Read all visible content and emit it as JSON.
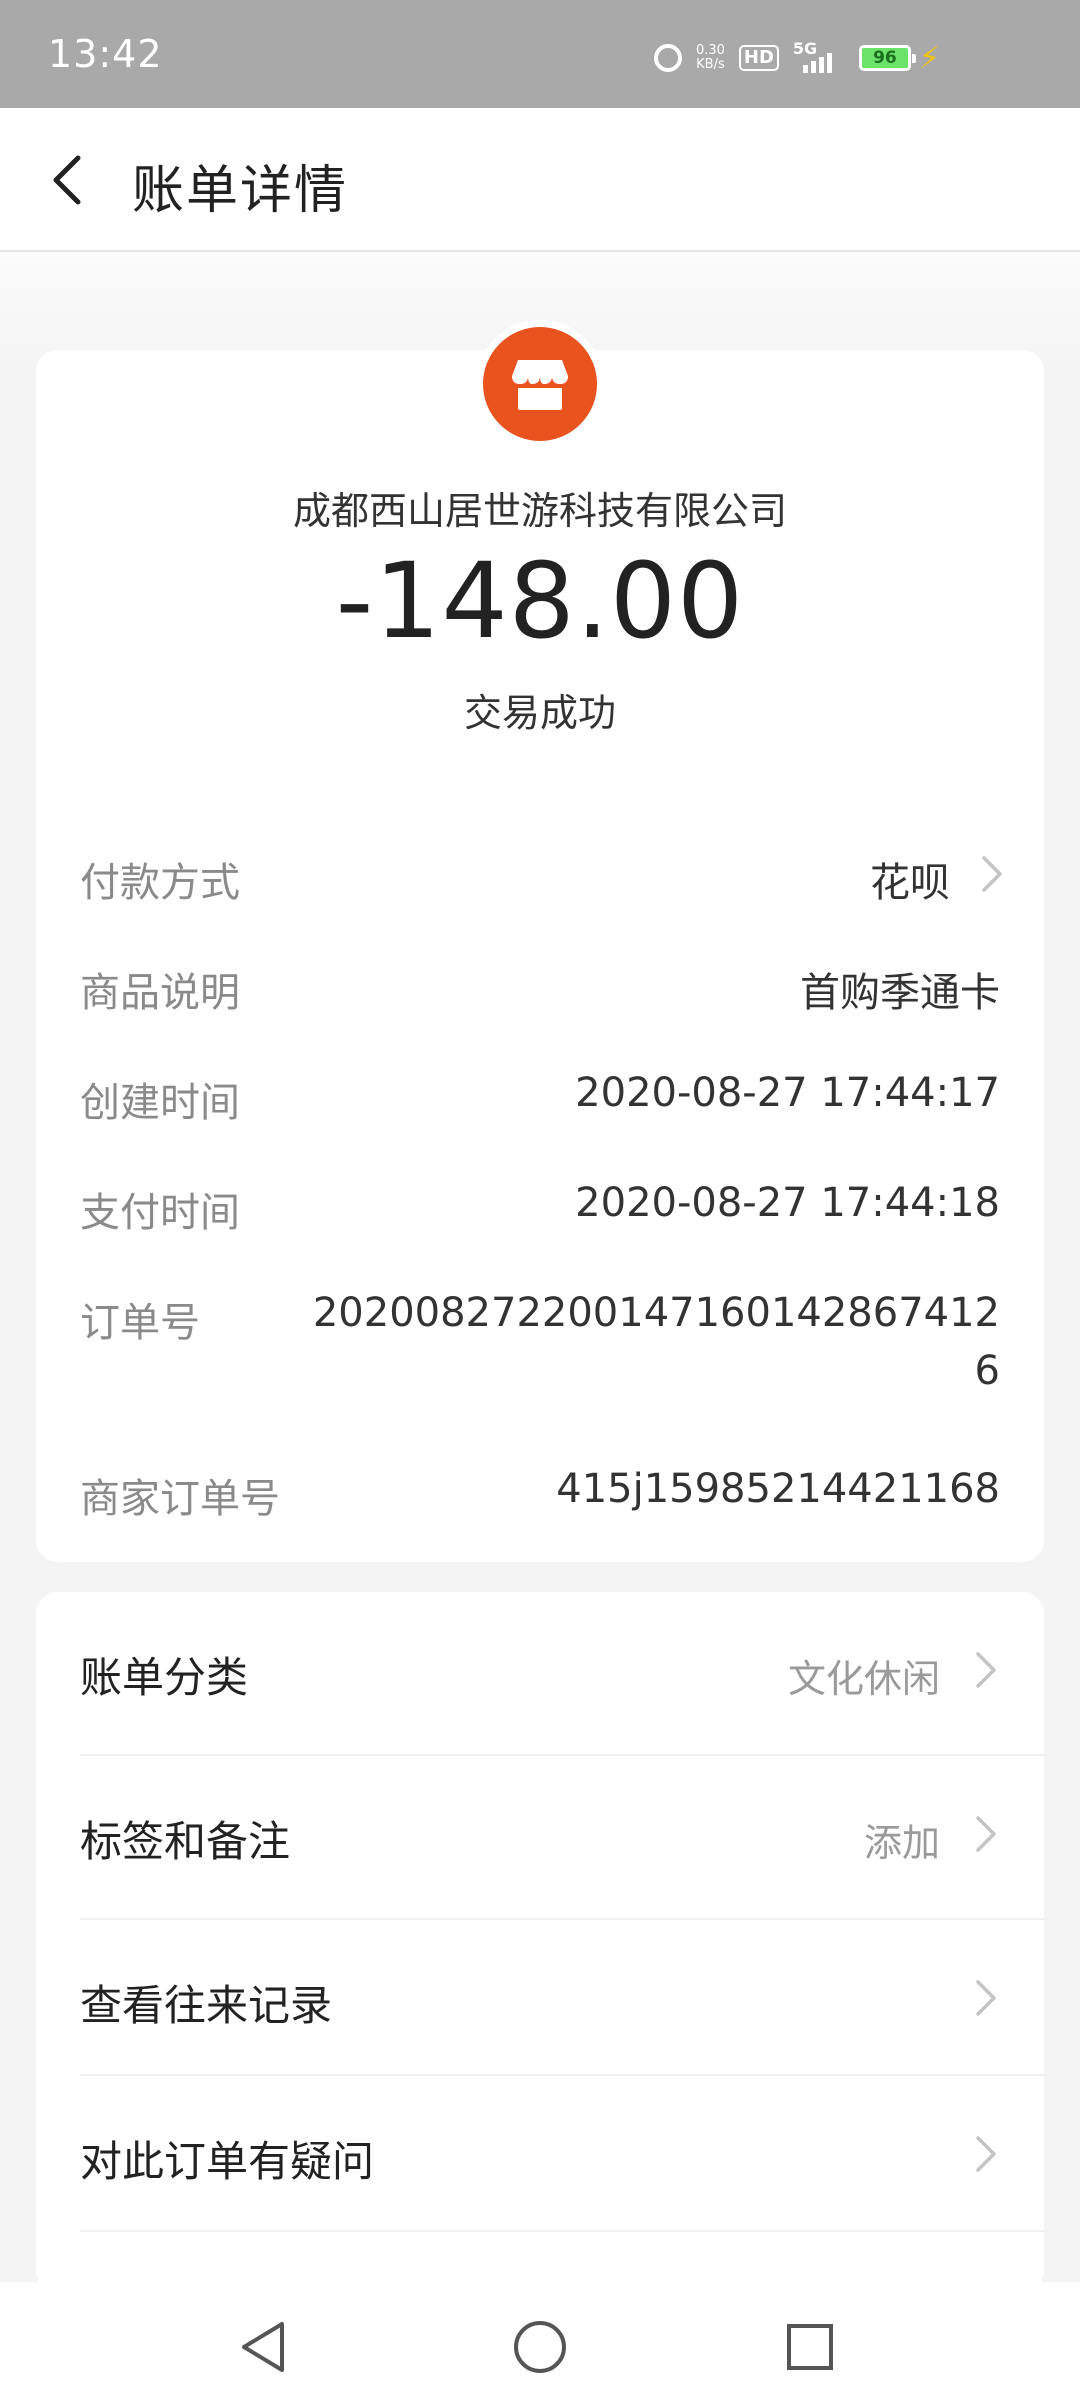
{
  "status_bar": {
    "time": "13:42",
    "net_speed_value": "0.30",
    "net_speed_unit": "KB/s",
    "hd_badge": "HD",
    "network": "5G",
    "battery": "96"
  },
  "header": {
    "title": "账单详情"
  },
  "transaction": {
    "merchant": "成都西山居世游科技有限公司",
    "amount": "-148.00",
    "status": "交易成功"
  },
  "details": [
    {
      "label": "付款方式",
      "value": "花呗"
    },
    {
      "label": "商品说明",
      "value": "首购季通卡"
    },
    {
      "label": "创建时间",
      "value": "2020-08-27 17:44:17"
    },
    {
      "label": "支付时间",
      "value": "2020-08-27 17:44:18"
    },
    {
      "label": "订单号",
      "value": "2020082722001471601428674126"
    },
    {
      "label": "商家订单号",
      "value": "415j15985214421168"
    }
  ],
  "actions": [
    {
      "label": "账单分类",
      "value": "文化休闲"
    },
    {
      "label": "标签和备注",
      "value": "添加"
    },
    {
      "label": "查看往来记录",
      "value": ""
    },
    {
      "label": "对此订单有疑问",
      "value": ""
    }
  ],
  "colors": {
    "merchant_icon": "#e8531e",
    "status_bar": "#a9a9a9"
  }
}
